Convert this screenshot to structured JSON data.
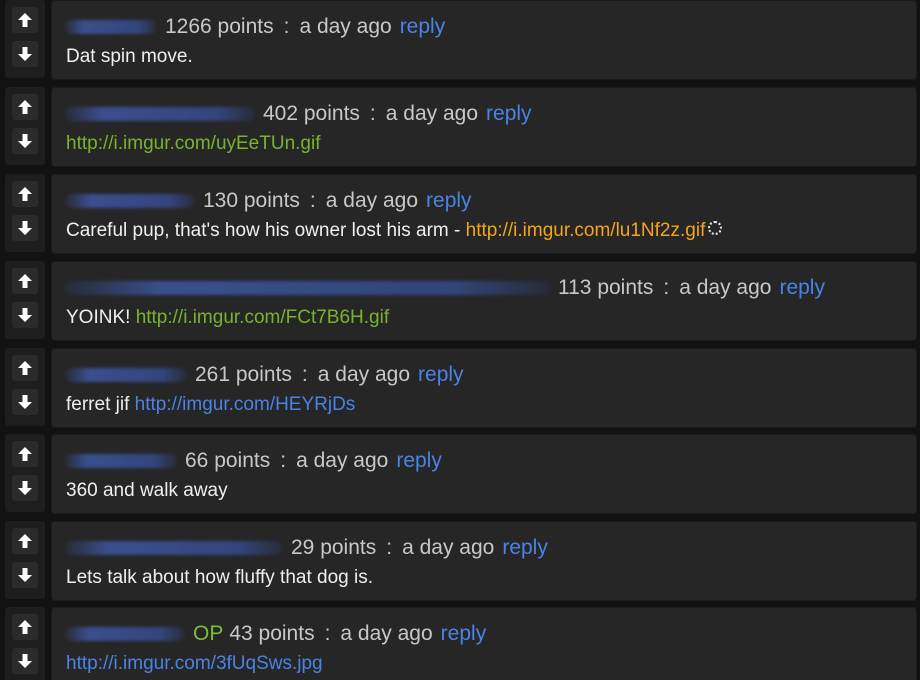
{
  "comments": [
    {
      "points": "1266 points",
      "time": "a day ago",
      "reply": "reply",
      "text": "Dat spin move.",
      "link": ""
    },
    {
      "points": "402 points",
      "time": "a day ago",
      "reply": "reply",
      "text": "",
      "link": "http://i.imgur.com/uyEeTUn.gif"
    },
    {
      "points": "130 points",
      "time": "a day ago",
      "reply": "reply",
      "text": "Careful pup, that's how his owner lost his arm - ",
      "link": "http://i.imgur.com/lu1Nf2z.gif"
    },
    {
      "points": "113 points",
      "time": "a day ago",
      "reply": "reply",
      "text": "YOINK! ",
      "link": "http://i.imgur.com/FCt7B6H.gif"
    },
    {
      "points": "261 points",
      "time": "a day ago",
      "reply": "reply",
      "text": "ferret jif ",
      "link": "http://imgur.com/HEYRjDs"
    },
    {
      "points": "66 points",
      "time": "a day ago",
      "reply": "reply",
      "text": "360 and walk away",
      "link": ""
    },
    {
      "points": "29 points",
      "time": "a day ago",
      "reply": "reply",
      "text": "Lets talk about how fluffy that dog is.",
      "link": ""
    },
    {
      "points": "43 points",
      "time": "a day ago",
      "reply": "reply",
      "op": "OP",
      "text": "",
      "link": "http://i.imgur.com/3fUqSws.jpg"
    }
  ],
  "separator": ":",
  "icons": {
    "upvote": "arrow-up-icon",
    "downvote": "arrow-down-icon",
    "loading": "spinner-icon"
  },
  "colors": {
    "background": "#121212",
    "card": "#262626",
    "meta_text": "#c8c8c8",
    "comment_text": "#efefef",
    "reply_link": "#4a83e6",
    "image_link": "#79b32e",
    "visited_link": "#f3a51c",
    "op_badge": "#7fbb3a"
  }
}
